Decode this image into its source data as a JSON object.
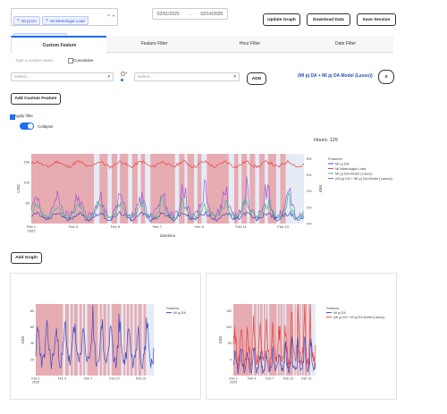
{
  "top": {
    "chips": [
      "MI pj DA",
      "MI Metrologia Load",
      "MI pj DA Model (Lasso)"
    ],
    "start_date": "02/01/2025",
    "end_date": "02/14/2025",
    "arrow": "→",
    "update_label": "Update Graph",
    "download_label": "Download Data",
    "save_label": "Save Session"
  },
  "tabs": [
    "Custom Feature",
    "Feature Filter",
    "Hour Filter",
    "Date Filter"
  ],
  "custom": {
    "name_placeholder": "Type a custom name",
    "cumulative_label": "Cumulative",
    "select1_placeholder": "Select...",
    "select2_placeholder": "Select...",
    "add_label": "ADD",
    "formula": "(MI pj DA + MI pj DA Model (Lasso))",
    "remove_label": "X",
    "add_custom_label": "Add Custom Feature"
  },
  "filter": {
    "apply_label": "Apply filter",
    "collapse_label": "Collapse"
  },
  "main_chart_hours": "Hours: 125",
  "add_graph_label": "Add Graph",
  "chart_data": [
    {
      "type": "line",
      "title": "Hours: 125",
      "xlabel": "datetime",
      "ylabel": "USD",
      "y2label": "MW",
      "x_ticks": [
        "Feb 1\n2025",
        "Feb 3",
        "Feb 5",
        "Feb 7",
        "Feb 9",
        "Feb 11",
        "Feb 13"
      ],
      "y_ticks": [
        "50",
        "100",
        "150"
      ],
      "y2_ticks": [
        "0%",
        "2%",
        "4%",
        "6%",
        "8%"
      ],
      "legend_title": "Features",
      "legend_position": "right",
      "series": [
        {
          "name": "MI pj DA",
          "color": "#3b4cc0"
        },
        {
          "name": "MI Metrologia Load",
          "color": "#e8453c"
        },
        {
          "name": "MI pj DA Model (Lasso)",
          "color": "#2fbf8f"
        },
        {
          "name": "(MI pj DA + MI pj DA Model (Lasso))",
          "color": "#9b59d6"
        }
      ]
    },
    {
      "type": "line",
      "xlabel": "",
      "ylabel": "USD",
      "x_ticks": [
        "Feb 1\n2025",
        "Feb 4",
        "Feb 7",
        "Feb 10",
        "Feb 13"
      ],
      "y_ticks": [
        "20",
        "40",
        "60",
        "80"
      ],
      "legend_title": "Features",
      "series": [
        {
          "name": "MI pj DA",
          "color": "#3b4cc0"
        }
      ]
    },
    {
      "type": "line",
      "xlabel": "",
      "ylabel": "USD",
      "x_ticks": [
        "Feb 1\n2025",
        "Feb 4",
        "Feb 7",
        "Feb 10",
        "Feb 13"
      ],
      "y_ticks": [
        "0",
        "50",
        "100",
        "150"
      ],
      "legend_title": "Features",
      "series": [
        {
          "name": "MI pj DA",
          "color": "#3b4cc0"
        },
        {
          "name": "(MI pj DA + MI pj DA Model (Lasso))",
          "color": "#e8453c"
        }
      ]
    }
  ]
}
